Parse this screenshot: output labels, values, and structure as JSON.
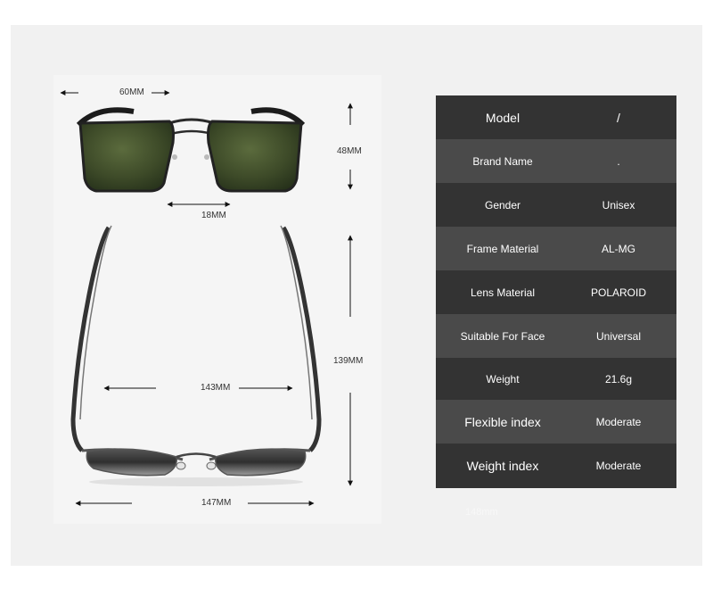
{
  "dimensions": {
    "lens_width": "60MM",
    "lens_height": "48MM",
    "bridge": "18MM",
    "temple_length": "139MM",
    "frame_width": "143MM",
    "total_width": "147MM"
  },
  "specs": [
    {
      "key": "Model",
      "value": "/"
    },
    {
      "key": "Brand Name",
      "value": "."
    },
    {
      "key": "Gender",
      "value": "Unisex"
    },
    {
      "key": "Frame Material",
      "value": "AL-MG"
    },
    {
      "key": "Lens Material",
      "value": "POLAROID"
    },
    {
      "key": "Suitable For Face",
      "value": "Universal"
    },
    {
      "key": "Weight",
      "value": "21.6g"
    },
    {
      "key": "Flexible index",
      "value": "Moderate"
    },
    {
      "key": "Weight index",
      "value": "Moderate"
    }
  ],
  "faint_note": "148mm",
  "colors": {
    "table_dark": "#333333",
    "table_light": "#4a4a4a",
    "lens_green": "#3f4f2a",
    "frame": "#2a2a2a"
  }
}
